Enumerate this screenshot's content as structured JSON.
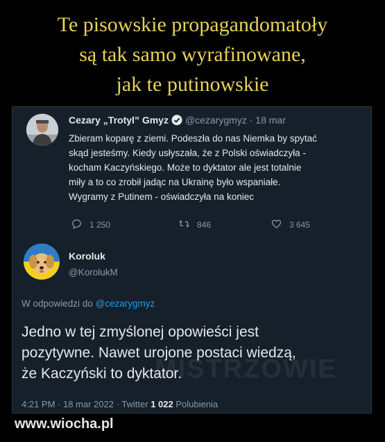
{
  "headline": {
    "line1": "Te pisowskie propagandomatoły",
    "line2": "są tak samo wyrafinowane,",
    "line3": "jak te putinowskie"
  },
  "tweet": {
    "author_name": "Cezary „Trotyl” Gmyz",
    "author_handle": "@cezarygmyz",
    "separator": "·",
    "time": "18 mar",
    "text_lines": [
      "Zbieram koparę z ziemi. Podeszła do nas Niemka by spytać",
      "skąd jesteśmy. Kiedy usłyszała, że z Polski oświadczyła -",
      "kocham Kaczyńskiego. Może to dyktator ale jest totalnie",
      "miły a to co zrobił jadąc na Ukrainę było wspaniałe.",
      "Wygramy z Putinem - oświadczyła na koniec"
    ],
    "actions": {
      "replies": "1 250",
      "retweets": "846",
      "likes": "3 645"
    },
    "icons": [
      "verified-badge-icon",
      "reply-icon",
      "retweet-icon",
      "like-icon"
    ]
  },
  "reply": {
    "author_name": "Koroluk",
    "author_handle": "@KorolukM",
    "replying_prefix": "W odpowiedzi do",
    "replying_handle": "@cezarygmyz",
    "text_lines": [
      "Jedno w tej zmyślonej opowieści jest",
      "pozytywne. Nawet urojone postaci wiedzą,",
      "że Kaczyński to dyktator."
    ],
    "meta_time": "4:21 PM · 18 mar 2022 · Twitter",
    "meta_likes_count": "1 022",
    "meta_likes_label": "Polubienia"
  },
  "watermark": "MISTRZOWIE",
  "site": "www.wiocha.pl",
  "colors": {
    "headline": "#e8d25a",
    "card_background": "#15202b",
    "link": "#1d9bf0",
    "muted": "#8b98a5",
    "text": "#e7e9ea"
  }
}
